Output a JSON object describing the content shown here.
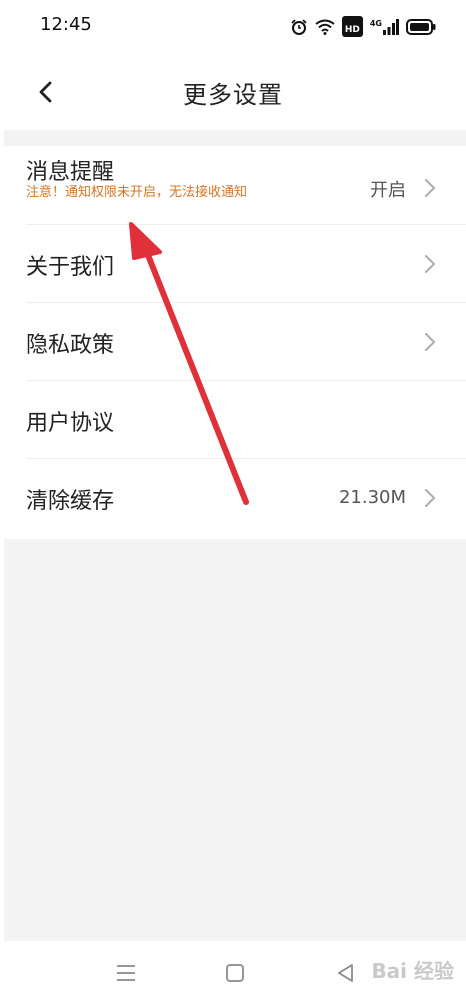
{
  "status_bar": {
    "time": "12:45",
    "hd_label": "HD",
    "network_label": "4G"
  },
  "header": {
    "title": "更多设置"
  },
  "settings": {
    "items": [
      {
        "label": "消息提醒",
        "warning": "注意！通知权限未开启，无法接收通知",
        "value": "开启"
      },
      {
        "label": "关于我们"
      },
      {
        "label": "隐私政策"
      },
      {
        "label": "用户协议"
      },
      {
        "label": "清除缓存",
        "value": "21.30M"
      }
    ]
  },
  "watermark": {
    "text": "Bai 经验"
  },
  "colors": {
    "warning": "#d9741f",
    "arrow": "#e0303a",
    "background_gray": "#f4f4f4"
  }
}
